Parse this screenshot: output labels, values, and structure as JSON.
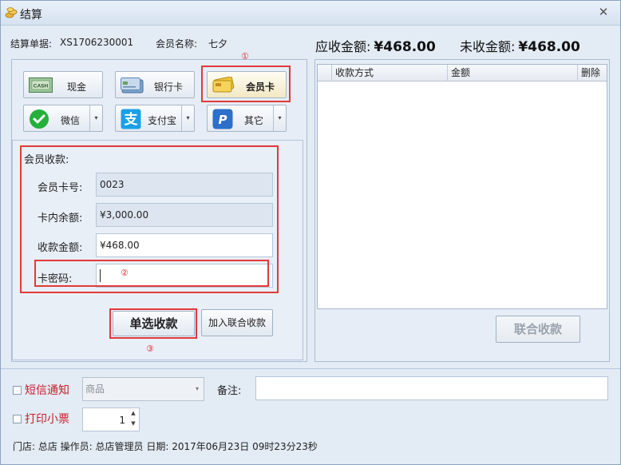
{
  "window": {
    "title": "结算",
    "close_glyph": "✕"
  },
  "header": {
    "bill_label": "结算单据:",
    "bill_no": "XS1706230001",
    "member_label": "会员名称:",
    "member_name": "七夕",
    "receivable_label": "应收金额:",
    "receivable_value": "¥468.00",
    "unreceived_label": "未收金额:",
    "unreceived_value": "¥468.00"
  },
  "payment_methods": {
    "cash": "现金",
    "bank_card": "银行卡",
    "member_card": "会员卡",
    "wechat": "微信",
    "alipay": "支付宝",
    "other": "其它",
    "dropdown_glyph": "▾"
  },
  "member_payment": {
    "section_title": "会员收款:",
    "card_no_label": "会员卡号:",
    "card_no_value": "0023",
    "balance_label": "卡内余额:",
    "balance_value": "¥3,000.00",
    "amount_label": "收款金额:",
    "amount_value": "¥468.00",
    "password_label": "卡密码:",
    "password_value": ""
  },
  "annotations": {
    "one": "①",
    "two": "②",
    "three": "③"
  },
  "actions": {
    "single_pay": "单选收款",
    "add_to_combined": "加入联合收款",
    "combined_pay": "联合收款"
  },
  "payment_grid": {
    "columns": [
      "收款方式",
      "金额",
      "删除"
    ],
    "rows": []
  },
  "options": {
    "sms_label": "短信通知",
    "sms_checked": false,
    "sms_template": "商品",
    "remark_label": "备注:",
    "remark_value": "",
    "print_label": "打印小票",
    "print_checked": false,
    "print_copies": "1"
  },
  "status": "门店: 总店   操作员: 总店管理员   日期: 2017年06月23日 09时23分23秒",
  "colors": {
    "highlight": "#e23a3a",
    "accent_red": "#c6212b"
  }
}
